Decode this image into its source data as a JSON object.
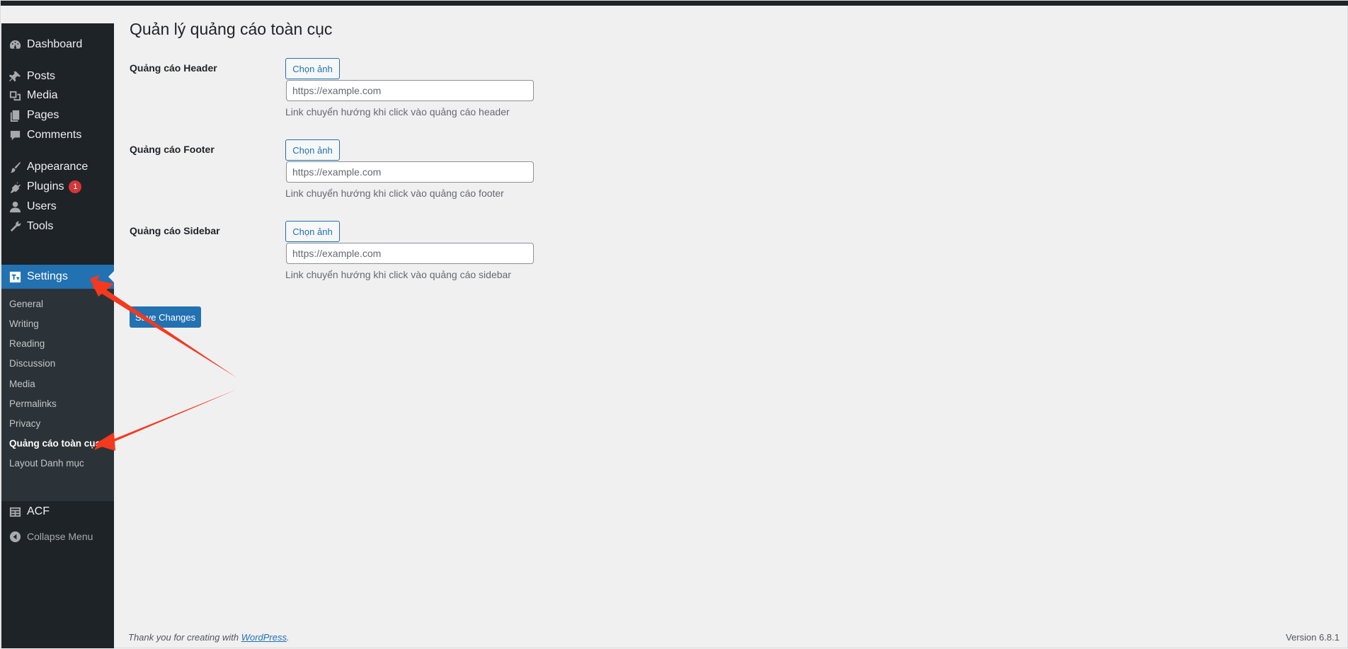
{
  "page": {
    "title": "Quản lý quảng cáo toàn cục"
  },
  "sidebar": {
    "items": [
      {
        "label": "Dashboard",
        "icon": "dashboard-icon"
      },
      {
        "label": "Posts",
        "icon": "pin-icon"
      },
      {
        "label": "Media",
        "icon": "media-icon"
      },
      {
        "label": "Pages",
        "icon": "pages-icon"
      },
      {
        "label": "Comments",
        "icon": "comment-icon"
      },
      {
        "label": "Appearance",
        "icon": "brush-icon"
      },
      {
        "label": "Plugins",
        "icon": "plug-icon",
        "badge": "1"
      },
      {
        "label": "Users",
        "icon": "user-icon"
      },
      {
        "label": "Tools",
        "icon": "wrench-icon"
      },
      {
        "label": "Settings",
        "icon": "settings-icon",
        "active": true
      },
      {
        "label": "ACF",
        "icon": "table-icon"
      }
    ],
    "submenu": [
      "General",
      "Writing",
      "Reading",
      "Discussion",
      "Media",
      "Permalinks",
      "Privacy",
      "Quảng cáo toàn cục",
      "Layout Danh mục"
    ],
    "collapse_label": "Collapse Menu"
  },
  "form": {
    "rows": [
      {
        "label": "Quảng cáo Header",
        "button": "Chọn ảnh",
        "placeholder": "https://example.com",
        "description": "Link chuyển hướng khi click vào quảng cáo header"
      },
      {
        "label": "Quảng cáo Footer",
        "button": "Chọn ảnh",
        "placeholder": "https://example.com",
        "description": "Link chuyển hướng khi click vào quảng cáo footer"
      },
      {
        "label": "Quảng cáo Sidebar",
        "button": "Chọn ảnh",
        "placeholder": "https://example.com",
        "description": "Link chuyển hướng khi click vào quảng cáo sidebar"
      }
    ],
    "save_label": "Save Changes"
  },
  "footer": {
    "thanks_prefix": "Thank you for creating with ",
    "link_text": "WordPress",
    "thanks_suffix": ".",
    "version": "Version 6.8.1"
  },
  "colors": {
    "accent": "#2271b1",
    "sidebar_bg": "#1d2327",
    "submenu_bg": "#2c3338",
    "badge": "#d63638",
    "annotation_arrow": "#f4391f"
  }
}
